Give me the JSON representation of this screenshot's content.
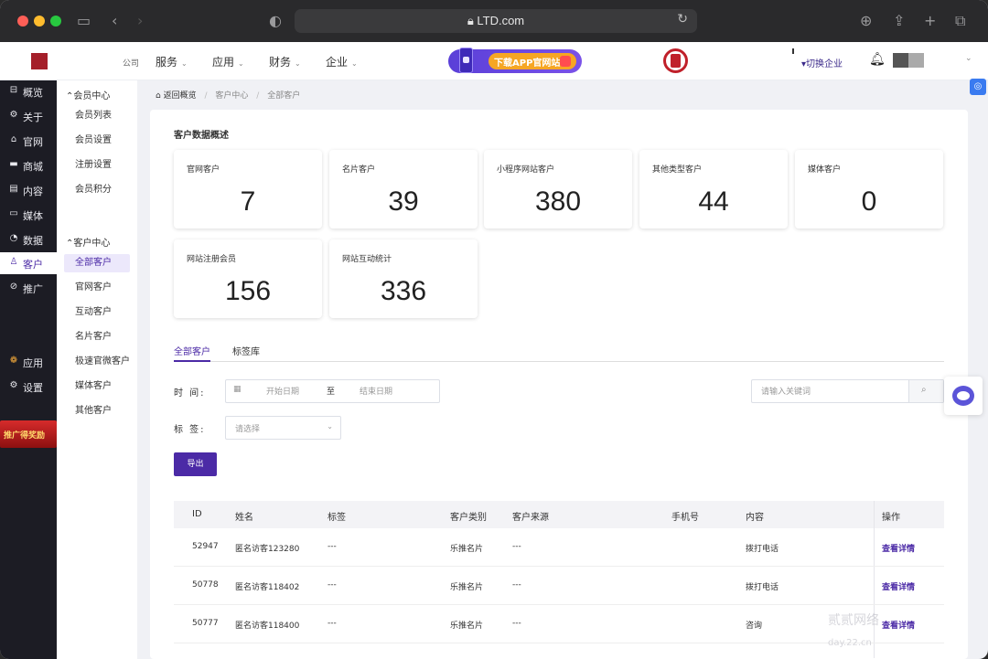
{
  "browser": {
    "url": "LTD.com"
  },
  "topnav": {
    "logo_tail": "公司",
    "items": [
      "服务",
      "应用",
      "财务",
      "企业"
    ],
    "promo_text": "下载APP官网站",
    "switch_company": "切换企业"
  },
  "dark_sidebar": {
    "items": [
      {
        "label": "概览",
        "icon": "⊟"
      },
      {
        "label": "关于",
        "icon": "⚙"
      },
      {
        "label": "官网",
        "icon": "⌂"
      },
      {
        "label": "商城",
        "icon": "▬"
      },
      {
        "label": "内容",
        "icon": "▤"
      },
      {
        "label": "媒体",
        "icon": "▭"
      },
      {
        "label": "数据",
        "icon": "◔"
      },
      {
        "label": "客户",
        "icon": "♙"
      },
      {
        "label": "推广",
        "icon": "⊘"
      },
      {
        "label": "应用",
        "icon": "❁"
      },
      {
        "label": "设置",
        "icon": "⚙"
      }
    ],
    "promo": "推广得奖励"
  },
  "sub_sidebar": {
    "groups": [
      {
        "title": "会员中心",
        "items": [
          "会员列表",
          "会员设置",
          "注册设置",
          "会员积分"
        ]
      },
      {
        "title": "客户中心",
        "items": [
          "全部客户",
          "官网客户",
          "互动客户",
          "名片客户",
          "极速官微客户",
          "媒体客户",
          "其他客户"
        ]
      }
    ]
  },
  "breadcrumb": {
    "back": "返回概览",
    "level1": "客户中心",
    "level2": "全部客户"
  },
  "overview": {
    "title": "客户数据概述",
    "cards": [
      {
        "label": "官网客户",
        "value": "7"
      },
      {
        "label": "名片客户",
        "value": "39"
      },
      {
        "label": "小程序网站客户",
        "value": "380"
      },
      {
        "label": "其他类型客户",
        "value": "44"
      },
      {
        "label": "媒体客户",
        "value": "0"
      },
      {
        "label": "网站注册会员",
        "value": "156"
      },
      {
        "label": "网站互动统计",
        "value": "336"
      }
    ]
  },
  "tabs": [
    "全部客户",
    "标签库"
  ],
  "filters": {
    "time_label": "时 间:",
    "start_placeholder": "开始日期",
    "to": "至",
    "end_placeholder": "结束日期",
    "tag_label": "标 签:",
    "tag_placeholder": "请选择",
    "search_placeholder": "请输入关键词",
    "export": "导出"
  },
  "table": {
    "columns": [
      "ID",
      "姓名",
      "标签",
      "客户类别",
      "客户来源",
      "手机号",
      "内容",
      "操作"
    ],
    "rows": [
      {
        "id": "52947",
        "name": "匿名访客123280",
        "tag": "---",
        "type": "乐推名片",
        "source": "---",
        "phone": "",
        "content": "拨打电话",
        "action": "查看详情"
      },
      {
        "id": "50778",
        "name": "匿名访客118402",
        "tag": "---",
        "type": "乐推名片",
        "source": "---",
        "phone": "",
        "content": "拨打电话",
        "action": "查看详情"
      },
      {
        "id": "50777",
        "name": "匿名访客118400",
        "tag": "---",
        "type": "乐推名片",
        "source": "---",
        "phone": "",
        "content": "咨询",
        "action": "查看详情"
      }
    ]
  },
  "watermark": {
    "line1": "贰贰网络",
    "line2": "day.22.cn"
  }
}
